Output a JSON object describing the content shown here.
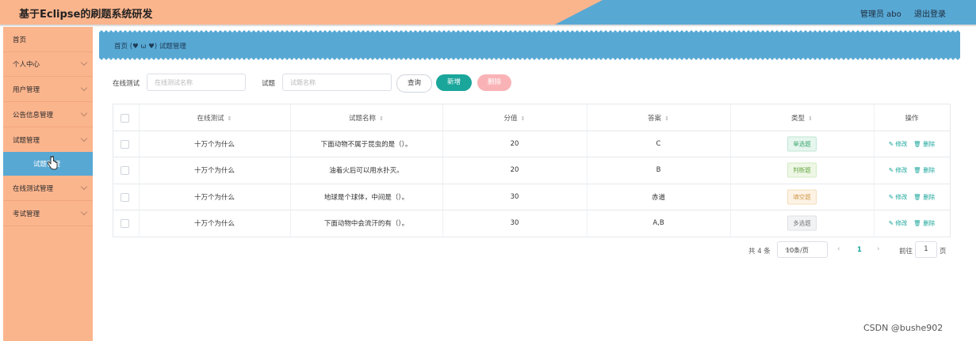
{
  "header": {
    "title": "基于Eclipse的刷题系统研发",
    "admin": "管理员 abo",
    "logout": "退出登录"
  },
  "sidebar": {
    "items": [
      {
        "label": "首页",
        "chevron": false
      },
      {
        "label": "个人中心",
        "chevron": true
      },
      {
        "label": "用户管理",
        "chevron": true
      },
      {
        "label": "公告信息管理",
        "chevron": true
      },
      {
        "label": "试题管理",
        "chevron": true
      },
      {
        "label": "在线测试管理",
        "chevron": true
      },
      {
        "label": "考试管理",
        "chevron": true
      }
    ],
    "active_sub": "试题管理"
  },
  "breadcrumb": {
    "home": "首页",
    "separator": "(♥ ω ♥)",
    "current": "试题管理"
  },
  "search": {
    "test_label": "在线测试",
    "test_placeholder": "在线测试名称",
    "question_label": "试题",
    "question_placeholder": "试题名称",
    "search_btn": "查询",
    "add_btn": "新增",
    "delete_btn": "删除"
  },
  "table": {
    "headers": [
      "在线测试",
      "试题名称",
      "分值",
      "答案",
      "类型",
      "操作"
    ],
    "rows": [
      {
        "test": "十万个为什么",
        "name": "下面动物不属于昆虫的是（）。",
        "score": "20",
        "answer": "C",
        "type": "单选题",
        "tag": "green"
      },
      {
        "test": "十万个为什么",
        "name": "油着火后可以用水扑灭。",
        "score": "20",
        "answer": "B",
        "type": "判断题",
        "tag": "green2"
      },
      {
        "test": "十万个为什么",
        "name": "地球是个球体，中间是（）。",
        "score": "30",
        "answer": "赤道",
        "type": "填空题",
        "tag": "yellow"
      },
      {
        "test": "十万个为什么",
        "name": "下面动物中会流汗的有（）。",
        "score": "30",
        "answer": "A,B",
        "type": "多选题",
        "tag": "gray"
      }
    ],
    "edit_label": "修改",
    "delete_label": "删除"
  },
  "pagination": {
    "total": "共 4 条",
    "page_size": "10条/页",
    "current": "1",
    "goto_label": "前往",
    "goto_value": "1",
    "page_suffix": "页"
  },
  "watermark": "CSDN @bushe902",
  "colors": {
    "accent_orange": "#fbb58d",
    "accent_blue": "#58a8d4",
    "primary_teal": "#1aa69b"
  }
}
